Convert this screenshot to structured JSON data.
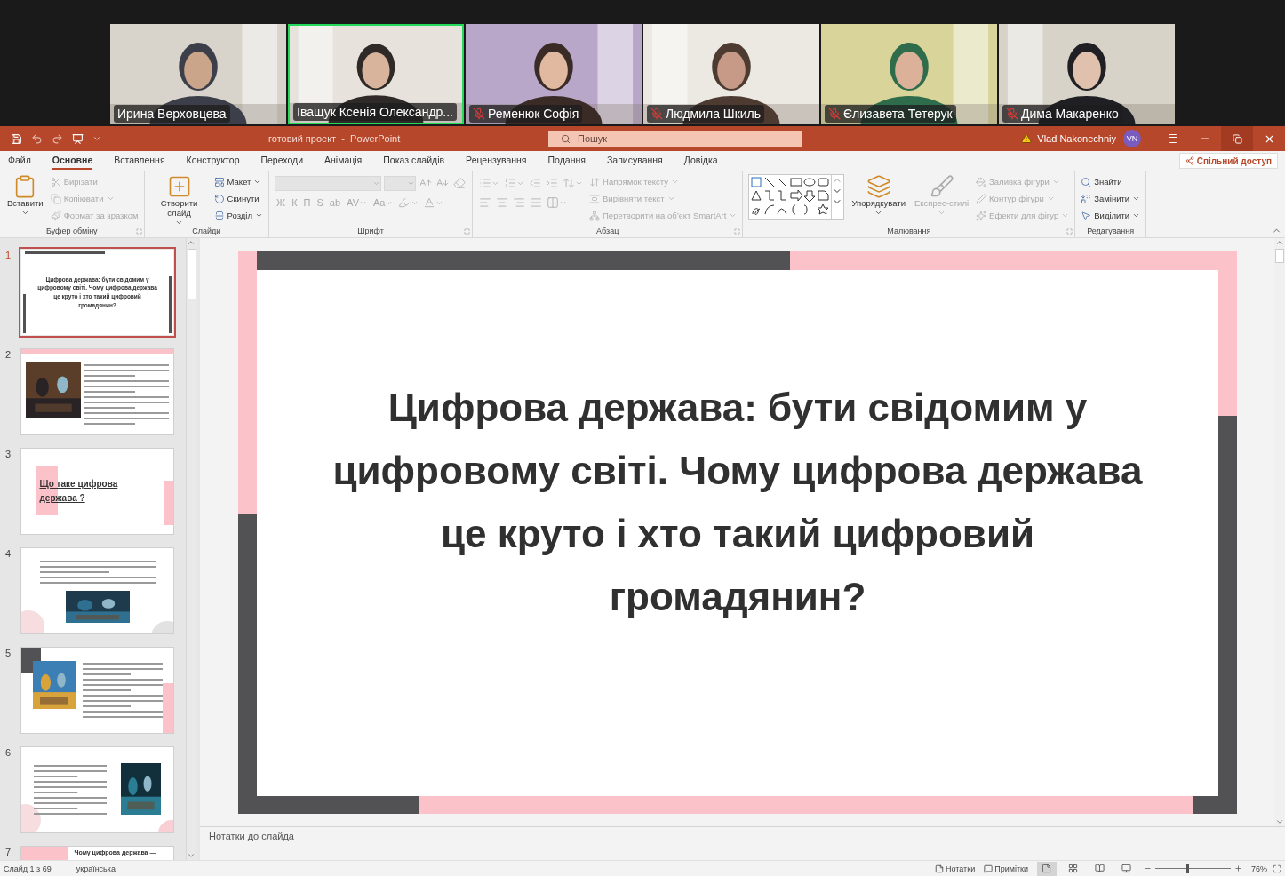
{
  "meeting": {
    "participants": [
      {
        "name": "Ирина Верховцева",
        "muted": false,
        "speaking": false
      },
      {
        "name": "Іващук Ксенія Олександр...",
        "muted": false,
        "speaking": true
      },
      {
        "name": "Ременюк Софія",
        "muted": true,
        "speaking": false
      },
      {
        "name": "Людмила Шкиль",
        "muted": true,
        "speaking": false
      },
      {
        "name": "Єлизавета Тетерук",
        "muted": true,
        "speaking": false
      },
      {
        "name": "Дима Макаренко",
        "muted": true,
        "speaking": false
      }
    ]
  },
  "app": {
    "title": "готовий проект  -  PowerPoint",
    "search": {
      "placeholder": "Пошук"
    },
    "user": {
      "name": "Vlad Nakonechniy",
      "initials": "VN",
      "warning": true
    }
  },
  "menu_tabs": [
    {
      "label": "Файл",
      "selected": false
    },
    {
      "label": "Основне",
      "selected": true
    },
    {
      "label": "Вставлення",
      "selected": false
    },
    {
      "label": "Конструктор",
      "selected": false
    },
    {
      "label": "Переходи",
      "selected": false
    },
    {
      "label": "Анімація",
      "selected": false
    },
    {
      "label": "Показ слайдів",
      "selected": false
    },
    {
      "label": "Рецензування",
      "selected": false
    },
    {
      "label": "Подання",
      "selected": false
    },
    {
      "label": "Записування",
      "selected": false
    },
    {
      "label": "Довідка",
      "selected": false
    }
  ],
  "share_button": "Спільний доступ",
  "ribbon_groups": [
    {
      "label": "Буфер обміну",
      "launcher": true,
      "columns": [
        {
          "rows": [
            [
              {
                "kind": "big",
                "label": "Вставити",
                "disabled": false,
                "dropdown": true
              }
            ]
          ]
        },
        {
          "rows": [
            [
              {
                "kind": "small",
                "label": "Вирізати",
                "disabled": true,
                "dropdown": false
              }
            ],
            [
              {
                "kind": "small",
                "label": "Копіювати",
                "disabled": true,
                "dropdown": true
              }
            ],
            [
              {
                "kind": "small",
                "label": "Формат за зразком",
                "disabled": true,
                "dropdown": false
              }
            ]
          ]
        }
      ]
    },
    {
      "label": "Слайди",
      "launcher": false,
      "columns": [
        {
          "rows": [
            [
              {
                "kind": "big",
                "label": "Створити слайд",
                "disabled": false,
                "dropdown": true
              }
            ]
          ]
        },
        {
          "rows": [
            [
              {
                "kind": "small",
                "label": "Макет",
                "disabled": false,
                "dropdown": true
              }
            ],
            [
              {
                "kind": "small",
                "label": "Скинути",
                "disabled": false,
                "dropdown": false
              }
            ],
            [
              {
                "kind": "small",
                "label": "Розділ",
                "disabled": false,
                "dropdown": true
              }
            ]
          ]
        }
      ]
    },
    {
      "label": "Шрифт",
      "launcher": true,
      "columns": [
        {
          "rows": [
            [
              {
                "kind": "font-combo",
                "disabled": true
              },
              {
                "kind": "size-combo",
                "disabled": true
              },
              {
                "kind": "icon",
                "disabled": true,
                "dropdown": false
              },
              {
                "kind": "icon",
                "disabled": true,
                "dropdown": false
              },
              {
                "kind": "icon",
                "disabled": true,
                "dropdown": false
              }
            ],
            [
              {
                "kind": "glyph",
                "label": "Ж",
                "disabled": true,
                "dropdown": false
              },
              {
                "kind": "glyph",
                "label": "К",
                "disabled": true,
                "dropdown": false
              },
              {
                "kind": "glyph",
                "label": "П",
                "disabled": true,
                "dropdown": false
              },
              {
                "kind": "glyph",
                "label": "S",
                "disabled": true,
                "dropdown": false
              },
              {
                "kind": "glyph",
                "label": "ab",
                "disabled": true,
                "dropdown": false
              },
              {
                "kind": "glyph",
                "label": "AV",
                "disabled": true,
                "dropdown": true
              },
              {
                "kind": "glyph",
                "label": "Aa",
                "disabled": true,
                "dropdown": true
              },
              {
                "kind": "icon",
                "disabled": true,
                "dropdown": true
              },
              {
                "kind": "icon",
                "disabled": true,
                "dropdown": true
              }
            ]
          ]
        }
      ]
    },
    {
      "label": "Абзац",
      "launcher": true,
      "columns": [
        {
          "rows": [
            [
              {
                "kind": "icon",
                "disabled": true,
                "dropdown": true
              },
              {
                "kind": "icon",
                "disabled": true,
                "dropdown": true
              },
              {
                "kind": "icon",
                "disabled": true,
                "dropdown": false
              },
              {
                "kind": "icon",
                "disabled": true,
                "dropdown": false
              },
              {
                "kind": "icon",
                "disabled": true,
                "dropdown": true
              }
            ],
            [
              {
                "kind": "icon",
                "disabled": true,
                "dropdown": false
              },
              {
                "kind": "icon",
                "disabled": true,
                "dropdown": false
              },
              {
                "kind": "icon",
                "disabled": true,
                "dropdown": false
              },
              {
                "kind": "icon",
                "disabled": true,
                "dropdown": false
              },
              {
                "kind": "icon",
                "disabled": true,
                "dropdown": true
              }
            ]
          ]
        },
        {
          "rows": [
            [
              {
                "kind": "small",
                "label": "Напрямок тексту",
                "disabled": true,
                "dropdown": true
              }
            ],
            [
              {
                "kind": "small",
                "label": "Вирівняти текст",
                "disabled": true,
                "dropdown": true
              }
            ],
            [
              {
                "kind": "small",
                "label": "Перетворити на об’єкт SmartArt",
                "disabled": true,
                "dropdown": true
              }
            ]
          ]
        }
      ]
    },
    {
      "label": "Малювання",
      "launcher": true,
      "columns": [
        {
          "rows": [
            [
              {
                "kind": "gallery"
              }
            ]
          ]
        },
        {
          "rows": [
            [
              {
                "kind": "big",
                "label": "Упорядкувати",
                "disabled": false,
                "dropdown": true
              }
            ]
          ]
        },
        {
          "rows": [
            [
              {
                "kind": "big",
                "label": "Експрес-стилі",
                "disabled": true,
                "dropdown": true
              }
            ]
          ]
        },
        {
          "rows": [
            [
              {
                "kind": "small",
                "label": "Заливка фігури",
                "disabled": true,
                "dropdown": true
              }
            ],
            [
              {
                "kind": "small",
                "label": "Контур фігури",
                "disabled": true,
                "dropdown": true
              }
            ],
            [
              {
                "kind": "small",
                "label": "Ефекти для фігур",
                "disabled": true,
                "dropdown": true
              }
            ]
          ]
        }
      ]
    },
    {
      "label": "Редагування",
      "launcher": false,
      "columns": [
        {
          "rows": [
            [
              {
                "kind": "small",
                "label": "Знайти",
                "disabled": false,
                "dropdown": false
              }
            ],
            [
              {
                "kind": "small",
                "label": "Замінити",
                "disabled": false,
                "dropdown": true
              }
            ],
            [
              {
                "kind": "small",
                "label": "Виділити",
                "disabled": false,
                "dropdown": true
              }
            ]
          ]
        }
      ]
    }
  ],
  "thumbnails": [
    {
      "number": "1",
      "selected": true,
      "kind": "title",
      "title": "Цифрова держава: бути свідомим у цифровому світі. Чому цифрова держава це круто і хто такий цифровий громадянин?"
    },
    {
      "number": "2",
      "selected": false,
      "kind": "photo-text"
    },
    {
      "number": "3",
      "selected": false,
      "kind": "heading",
      "title": "Що таке цифрова держава ?"
    },
    {
      "number": "4",
      "selected": false,
      "kind": "quote-picture"
    },
    {
      "number": "5",
      "selected": false,
      "kind": "picture-text"
    },
    {
      "number": "6",
      "selected": false,
      "kind": "text-picture"
    },
    {
      "number": "7",
      "selected": false,
      "kind": "heading-bar",
      "title": "Чому цифрова держава —"
    }
  ],
  "slide": {
    "title": "Цифрова держава: бути свідомим у цифровому світі. Чому цифрова держава це круто і хто такий цифровий громадянин?"
  },
  "notes": {
    "placeholder": "Нотатки до слайда"
  },
  "status_bar": {
    "slide_count": "Слайд 1 з 69",
    "language": "українська",
    "notes_button": "Нотатки",
    "comments_button": "Примітки",
    "views": [
      {
        "kind": "normal",
        "selected": true
      },
      {
        "kind": "sorter",
        "selected": false
      },
      {
        "kind": "reading",
        "selected": false
      },
      {
        "kind": "presenter",
        "selected": false
      }
    ],
    "zoom": {
      "level": 0.42,
      "value": "76%"
    }
  }
}
